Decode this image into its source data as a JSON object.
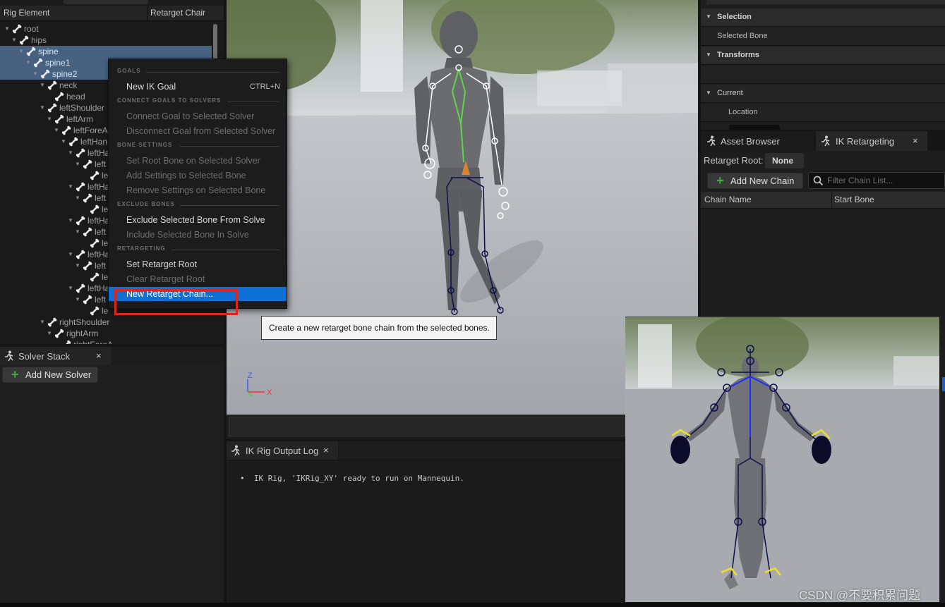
{
  "rig_panel": {
    "col_element": "Rig Element",
    "col_chain": "Retarget Chair",
    "items": [
      {
        "label": "root",
        "depth": 0,
        "selected": false
      },
      {
        "label": "hips",
        "depth": 1,
        "selected": false
      },
      {
        "label": "spine",
        "depth": 2,
        "selected": true
      },
      {
        "label": "spine1",
        "depth": 3,
        "selected": true
      },
      {
        "label": "spine2",
        "depth": 4,
        "selected": true
      },
      {
        "label": "neck",
        "depth": 5,
        "selected": false
      },
      {
        "label": "head",
        "depth": 6,
        "selected": false
      },
      {
        "label": "leftShoulder",
        "depth": 5,
        "selected": false
      },
      {
        "label": "leftArm",
        "depth": 6,
        "selected": false
      },
      {
        "label": "leftForeA",
        "depth": 7,
        "selected": false
      },
      {
        "label": "leftHan",
        "depth": 8,
        "selected": false
      },
      {
        "label": "leftHa",
        "depth": 9,
        "selected": false
      },
      {
        "label": "left",
        "depth": 10,
        "selected": false
      },
      {
        "label": "le",
        "depth": 11,
        "selected": false
      },
      {
        "label": "leftHa",
        "depth": 9,
        "selected": false
      },
      {
        "label": "left",
        "depth": 10,
        "selected": false
      },
      {
        "label": "le",
        "depth": 11,
        "selected": false
      },
      {
        "label": "leftHa",
        "depth": 9,
        "selected": false
      },
      {
        "label": "left",
        "depth": 10,
        "selected": false
      },
      {
        "label": "le",
        "depth": 11,
        "selected": false
      },
      {
        "label": "leftHa",
        "depth": 9,
        "selected": false
      },
      {
        "label": "left",
        "depth": 10,
        "selected": false
      },
      {
        "label": "le",
        "depth": 11,
        "selected": false
      },
      {
        "label": "leftHa",
        "depth": 9,
        "selected": false
      },
      {
        "label": "left",
        "depth": 10,
        "selected": false
      },
      {
        "label": "le",
        "depth": 11,
        "selected": false
      },
      {
        "label": "rightShoulder",
        "depth": 5,
        "selected": false
      },
      {
        "label": "rightArm",
        "depth": 6,
        "selected": false
      },
      {
        "label": "rightForeA",
        "depth": 7,
        "selected": false
      }
    ]
  },
  "solver_stack": {
    "tab_label": "Solver Stack",
    "close_glyph": "×",
    "add_button": "Add New Solver"
  },
  "context_menu": {
    "sections": [
      {
        "title": "GOALS",
        "items": [
          {
            "label": "New IK Goal",
            "shortcut": "CTRL+N",
            "enabled": true,
            "highlighted": false
          }
        ]
      },
      {
        "title": "CONNECT GOALS TO SOLVERS",
        "items": [
          {
            "label": "Connect Goal to Selected Solver",
            "enabled": false,
            "highlighted": false
          },
          {
            "label": "Disconnect Goal from Selected Solver",
            "enabled": false,
            "highlighted": false
          }
        ]
      },
      {
        "title": "BONE SETTINGS",
        "items": [
          {
            "label": "Set Root Bone on Selected Solver",
            "enabled": false,
            "highlighted": false
          },
          {
            "label": "Add Settings to Selected Bone",
            "enabled": false,
            "highlighted": false
          },
          {
            "label": "Remove Settings on Selected Bone",
            "enabled": false,
            "highlighted": false
          }
        ]
      },
      {
        "title": "EXCLUDE BONES",
        "items": [
          {
            "label": "Exclude Selected Bone From Solve",
            "enabled": true,
            "highlighted": false
          },
          {
            "label": "Include Selected Bone In Solve",
            "enabled": false,
            "highlighted": false
          }
        ]
      },
      {
        "title": "RETARGETING",
        "items": [
          {
            "label": "Set Retarget Root",
            "enabled": true,
            "highlighted": false
          },
          {
            "label": "Clear Retarget Root",
            "enabled": false,
            "highlighted": false
          },
          {
            "label": "New Retarget Chain...",
            "enabled": true,
            "highlighted": true
          }
        ]
      }
    ]
  },
  "tooltip": {
    "text": "Create a new retarget bone chain from the selected bones."
  },
  "viewport": {
    "axis_z": "Z",
    "axis_x": "X"
  },
  "output_log": {
    "tab_label": "IK Rig Output Log",
    "close_glyph": "×",
    "lines": [
      "IK Rig, 'IKRig_XY' ready to run on Mannequin."
    ]
  },
  "details": {
    "selection_header": "Selection",
    "selected_bone_label": "Selected Bone",
    "transforms_header": "Transforms",
    "current_header": "Current",
    "location_label": "Location"
  },
  "retargeting": {
    "tab_asset_browser": "Asset Browser",
    "tab_ik_retargeting": "IK Retargeting",
    "close_glyph": "×",
    "root_label": "Retarget Root:",
    "root_value": "None",
    "add_chain_button": "Add New Chain",
    "filter_placeholder": "Filter Chain List...",
    "col_chain_name": "Chain Name",
    "col_start_bone": "Start Bone"
  },
  "watermark": "CSDN @不要积累问题",
  "colors": {
    "selection": "#476181",
    "menu_highlight": "#0e6fd4",
    "callout_red": "#e0251c",
    "chain_green": "#5fd44a",
    "skeleton_navy": "#0a0f4a"
  }
}
